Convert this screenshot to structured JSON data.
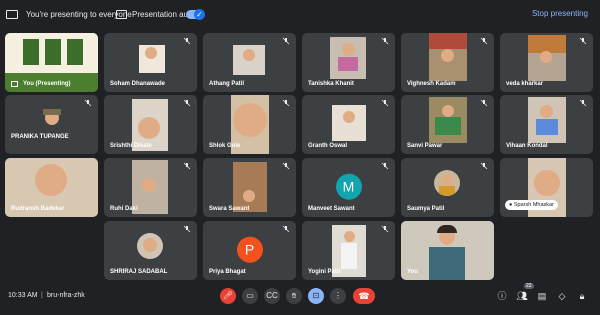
{
  "topbar": {
    "presenting_text": "You're presenting to everyone",
    "audio_text": "Presentation audio",
    "stop_label": "Stop presenting"
  },
  "tiles": [
    {
      "name": "You (Presenting)"
    },
    {
      "name": "Soham Dhanawade"
    },
    {
      "name": "Athang Patil"
    },
    {
      "name": "Tanishka Khanit"
    },
    {
      "name": "Vighnesh Kadam"
    },
    {
      "name": "veda kharkar"
    },
    {
      "name": "PRANIKA TUPANGE"
    },
    {
      "name": "Srishthi Disale"
    },
    {
      "name": "Shlok Gole"
    },
    {
      "name": "Granth Oswal"
    },
    {
      "name": "Sanvi Pawar"
    },
    {
      "name": "Vihaan Kondal"
    },
    {
      "name": "Rudransh Badekar"
    },
    {
      "name": "Ruhi Daki"
    },
    {
      "name": "Swara Sawant"
    },
    {
      "name": "Manveet Sawant",
      "initial": "M",
      "color": "#12a4af"
    },
    {
      "name": "Saumya Patil"
    },
    {
      "name": "Sparsh Mhaskar"
    },
    {
      "name": "SHRIRAJ SADABAL"
    },
    {
      "name": "Priya Bhagat",
      "initial": "P",
      "color": "#f4511e"
    },
    {
      "name": "Yogini Patil"
    },
    {
      "name": "You"
    }
  ],
  "bottombar": {
    "time": "10:33 AM",
    "meeting_code": "bru-nfra-zhk",
    "participants_count": "22"
  },
  "icons": {
    "mic_off": "mic-off-icon",
    "camera": "camera-icon",
    "captions": "captions-icon",
    "hand": "raise-hand-icon",
    "present": "present-icon",
    "more": "more-icon",
    "end": "end-call-icon",
    "info": "info-icon",
    "people": "people-icon",
    "chat": "chat-icon",
    "activities": "activities-icon",
    "lock": "host-controls-icon"
  }
}
